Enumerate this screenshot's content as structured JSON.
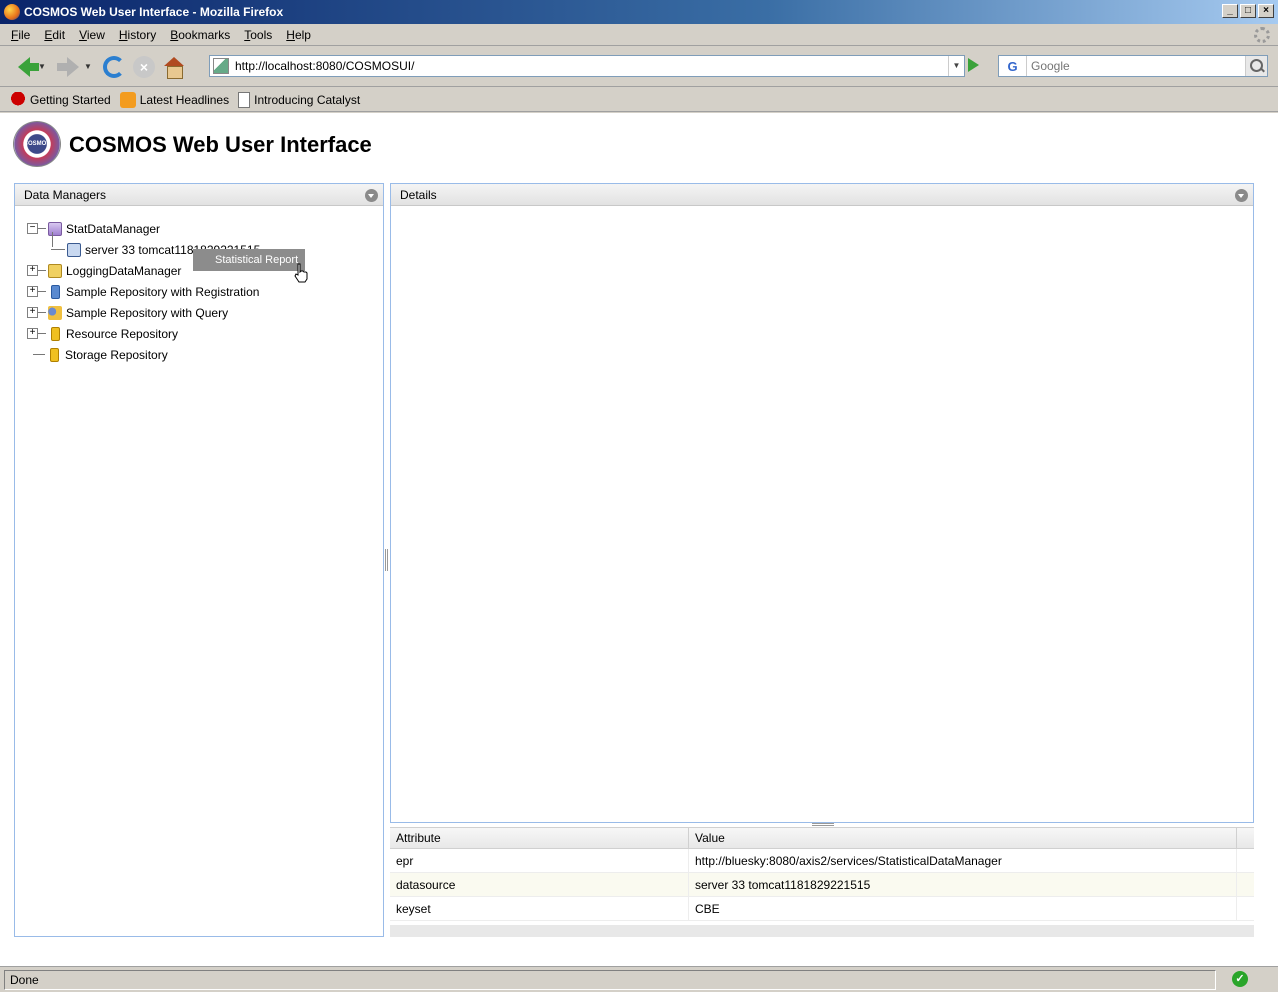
{
  "window": {
    "title": "COSMOS Web User Interface - Mozilla Firefox",
    "controls": [
      "_",
      "□",
      "×"
    ]
  },
  "menu": {
    "items": [
      {
        "label": "File",
        "mnemonic": "F",
        "rest": "ile"
      },
      {
        "label": "Edit",
        "mnemonic": "E",
        "rest": "dit"
      },
      {
        "label": "View",
        "mnemonic": "V",
        "rest": "iew"
      },
      {
        "label": "History",
        "mnemonic": "H",
        "rest": "istory"
      },
      {
        "label": "Bookmarks",
        "mnemonic": "B",
        "rest": "ookmarks"
      },
      {
        "label": "Tools",
        "mnemonic": "T",
        "rest": "ools"
      },
      {
        "label": "Help",
        "mnemonic": "H",
        "rest": "elp"
      }
    ]
  },
  "navigation": {
    "url": "http://localhost:8080/COSMOSUI/",
    "search_placeholder": "Google",
    "search_engine_glyph": "G",
    "stop_glyph": "×",
    "dropdown_glyph": "▼"
  },
  "bookmarks": {
    "items": [
      {
        "label": "Getting Started",
        "icon": "redhat-icon"
      },
      {
        "label": "Latest Headlines",
        "icon": "rss-icon"
      },
      {
        "label": "Introducing Catalyst",
        "icon": "page-icon"
      }
    ]
  },
  "app": {
    "title": "COSMOS Web User Interface",
    "logo_text": "COSMOS"
  },
  "data_managers": {
    "title": "Data Managers",
    "tree": {
      "stat": {
        "label": "StatDataManager",
        "toggle": "−",
        "child": "server 33 tomcat1181829221515"
      },
      "logging": {
        "label": "LoggingDataManager",
        "toggle": "+"
      },
      "registration": {
        "label": "Sample Repository with Registration",
        "toggle": "+"
      },
      "query": {
        "label": "Sample Repository with Query",
        "toggle": "+"
      },
      "resource": {
        "label": "Resource Repository",
        "toggle": "+"
      },
      "storage": {
        "label": "Storage Repository"
      }
    },
    "context_tooltip": "Statistical Report"
  },
  "details": {
    "title": "Details",
    "columns": {
      "attribute": "Attribute",
      "value": "Value"
    },
    "rows": [
      {
        "attribute": "epr",
        "value": "http://bluesky:8080/axis2/services/StatisticalDataManager"
      },
      {
        "attribute": "datasource",
        "value": "server 33 tomcat1181829221515"
      },
      {
        "attribute": "keyset",
        "value": "CBE"
      }
    ]
  },
  "status": {
    "text": "Done",
    "ok_glyph": "✓"
  },
  "colors": {
    "panel_border": "#99bbe8",
    "titlebar_start": "#0a246a",
    "tooltip_bg": "#8c8c8c"
  }
}
